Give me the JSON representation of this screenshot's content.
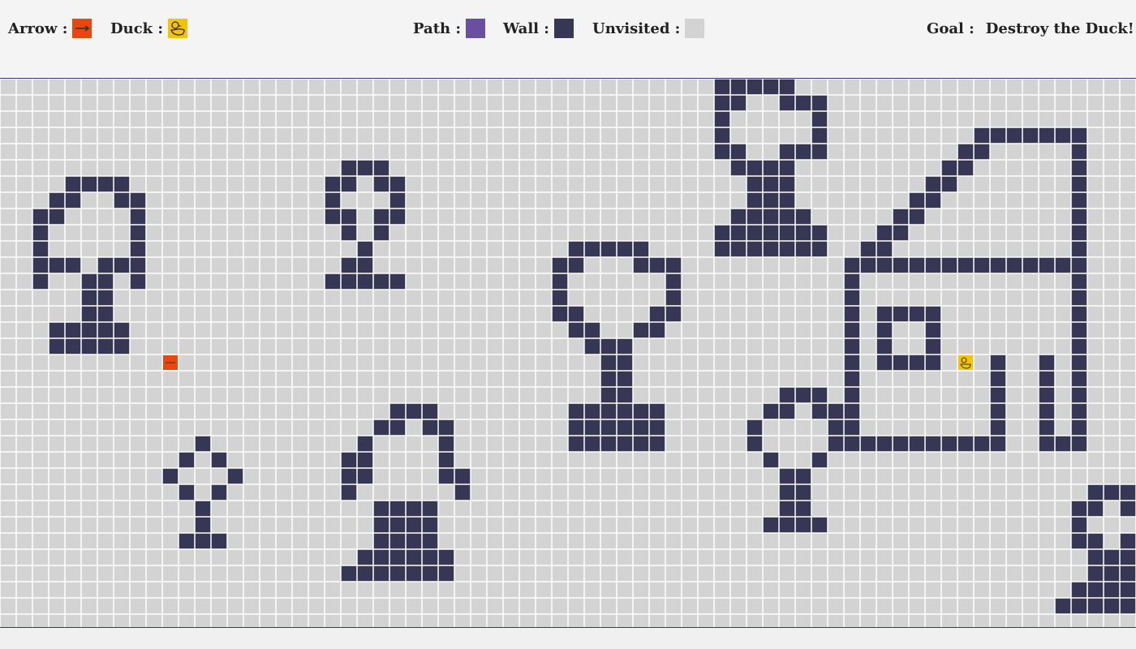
{
  "legend": {
    "arrow_label": "Arrow :",
    "duck_label": "Duck :",
    "path_label": "Path :",
    "wall_label": "Wall :",
    "unvisited_label": "Unvisited :",
    "goal_label": "Goal :",
    "goal_text": "Destroy the Duck!!"
  },
  "colors": {
    "arrow": "#e8470f",
    "duck": "#f5c400",
    "path": "#6a4fa0",
    "wall": "#373654",
    "unvisited": "#d3d3d3",
    "gridline": "#ffffff"
  },
  "icons": {
    "arrow": "arrow-icon",
    "duck": "duck-icon"
  },
  "grid": {
    "cols": 70,
    "rows": 34,
    "arrow_cell": [
      10,
      17
    ],
    "duck_cell": [
      59,
      17
    ]
  }
}
